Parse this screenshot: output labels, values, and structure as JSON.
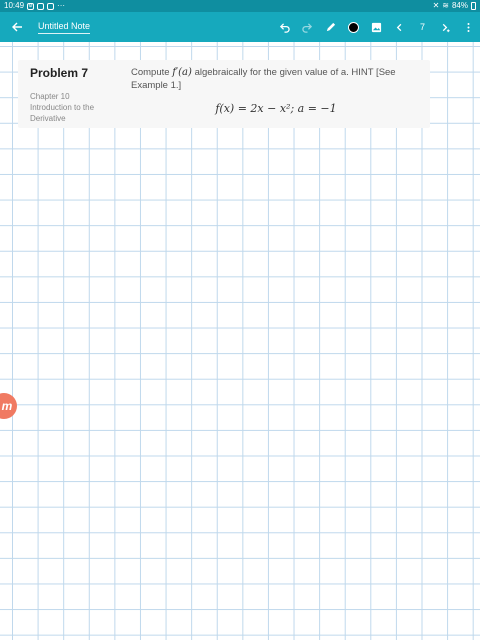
{
  "status_bar": {
    "time": "10:49",
    "overflow": "···",
    "battery": "84%",
    "icons": [
      "settings-icon",
      "app-icon",
      "app-icon",
      "wifi-icon",
      "battery-icon"
    ]
  },
  "app_bar": {
    "title": "Untitled Note",
    "page_number": "7",
    "pen_color": "#000000",
    "background_color": "#16a9bd",
    "status_color": "#0f8ea0"
  },
  "problem": {
    "title": "Problem 7",
    "chapter": "Chapter 10",
    "section_line1": "Introduction to the",
    "section_line2": "Derivative",
    "text_before": "Compute ",
    "text_math": "f′(a)",
    "text_after": " algebraically for the given value of a. HINT [See Example 1.]",
    "equation": "f(x) = 2x − x²; a = −1"
  },
  "logo": {
    "letter": "m"
  }
}
